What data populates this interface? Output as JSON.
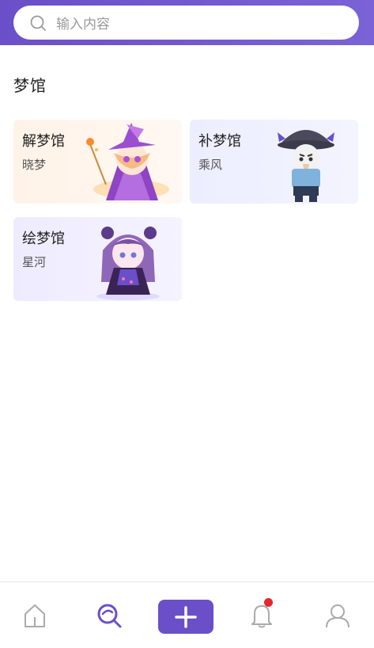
{
  "search": {
    "placeholder": "输入内容",
    "icon": "search-icon"
  },
  "section": {
    "title": "梦馆"
  },
  "cards": [
    {
      "title": "解梦馆",
      "subtitle": "晓梦",
      "art": "witch-girl-illustration"
    },
    {
      "title": "补梦馆",
      "subtitle": "乘风",
      "art": "plague-doctor-illustration"
    },
    {
      "title": "绘梦馆",
      "subtitle": "星河",
      "art": "gothic-girl-illustration"
    }
  ],
  "tabbar": {
    "items": [
      "home-icon",
      "discover-icon",
      "add-icon",
      "bell-icon",
      "user-icon"
    ],
    "active": "discover-icon",
    "accent": "#6a4fc9",
    "badge_color": "#e5262d"
  }
}
